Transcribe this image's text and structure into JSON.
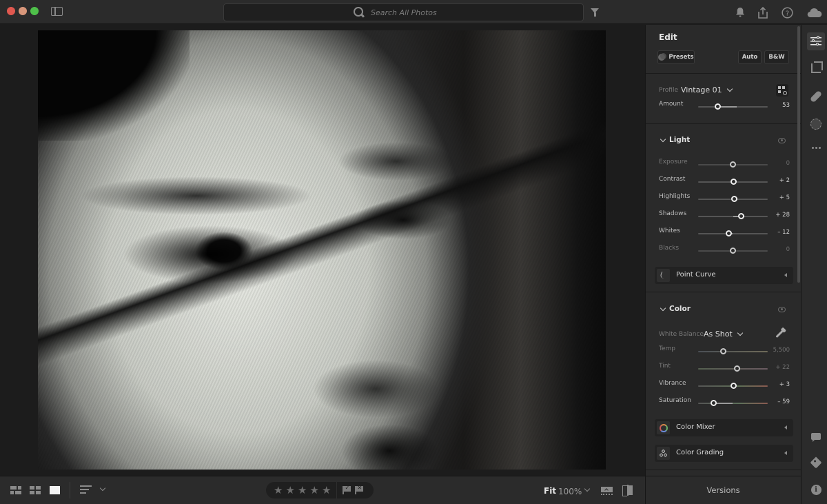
{
  "titlebar": {
    "search_placeholder": "Search All Photos"
  },
  "bottombar": {
    "stars": [
      "★",
      "★",
      "★",
      "★",
      "★"
    ],
    "rating": 0,
    "flag_pick_glyph": "✓",
    "flag_reject_glyph": "✕",
    "fit_label": "Fit",
    "zoom_level": "100%"
  },
  "photo": {
    "description": "Close-up black and white sketch-style portrait of a face"
  },
  "edit": {
    "title": "Edit",
    "presets_label": "Presets",
    "auto_label": "Auto",
    "bw_label": "B&W",
    "profile_label": "Profile",
    "profile_value": "Vintage 01",
    "amount": {
      "label": "Amount",
      "value": "53",
      "fraction": 0.28
    },
    "light": {
      "title": "Light",
      "sliders": [
        {
          "label": "Exposure",
          "value": "0",
          "fraction": 0.5,
          "dim": true
        },
        {
          "label": "Contrast",
          "value": "+ 2",
          "fraction": 0.51,
          "dim": false
        },
        {
          "label": "Highlights",
          "value": "+ 5",
          "fraction": 0.52,
          "dim": false
        },
        {
          "label": "Shadows",
          "value": "+ 28",
          "fraction": 0.62,
          "dim": false
        },
        {
          "label": "Whites",
          "value": "– 12",
          "fraction": 0.44,
          "dim": false
        },
        {
          "label": "Blacks",
          "value": "0",
          "fraction": 0.5,
          "dim": true
        }
      ]
    },
    "point_curve_label": "Point Curve",
    "color": {
      "title": "Color",
      "white_balance_label": "White Balance",
      "white_balance_value": "As Shot",
      "sliders": [
        {
          "label": "Temp",
          "value": "5,500",
          "fraction": 0.36,
          "dim": true
        },
        {
          "label": "Tint",
          "value": "+ 22",
          "fraction": 0.56,
          "dim": true
        },
        {
          "label": "Vibrance",
          "value": "+ 3",
          "fraction": 0.51,
          "dim": false
        },
        {
          "label": "Saturation",
          "value": "– 59",
          "fraction": 0.22,
          "dim": false
        }
      ]
    },
    "color_mixer_label": "Color Mixer",
    "color_grading_label": "Color Grading"
  },
  "versions_label": "Versions",
  "toolstrip": {
    "info_glyph": "i"
  }
}
